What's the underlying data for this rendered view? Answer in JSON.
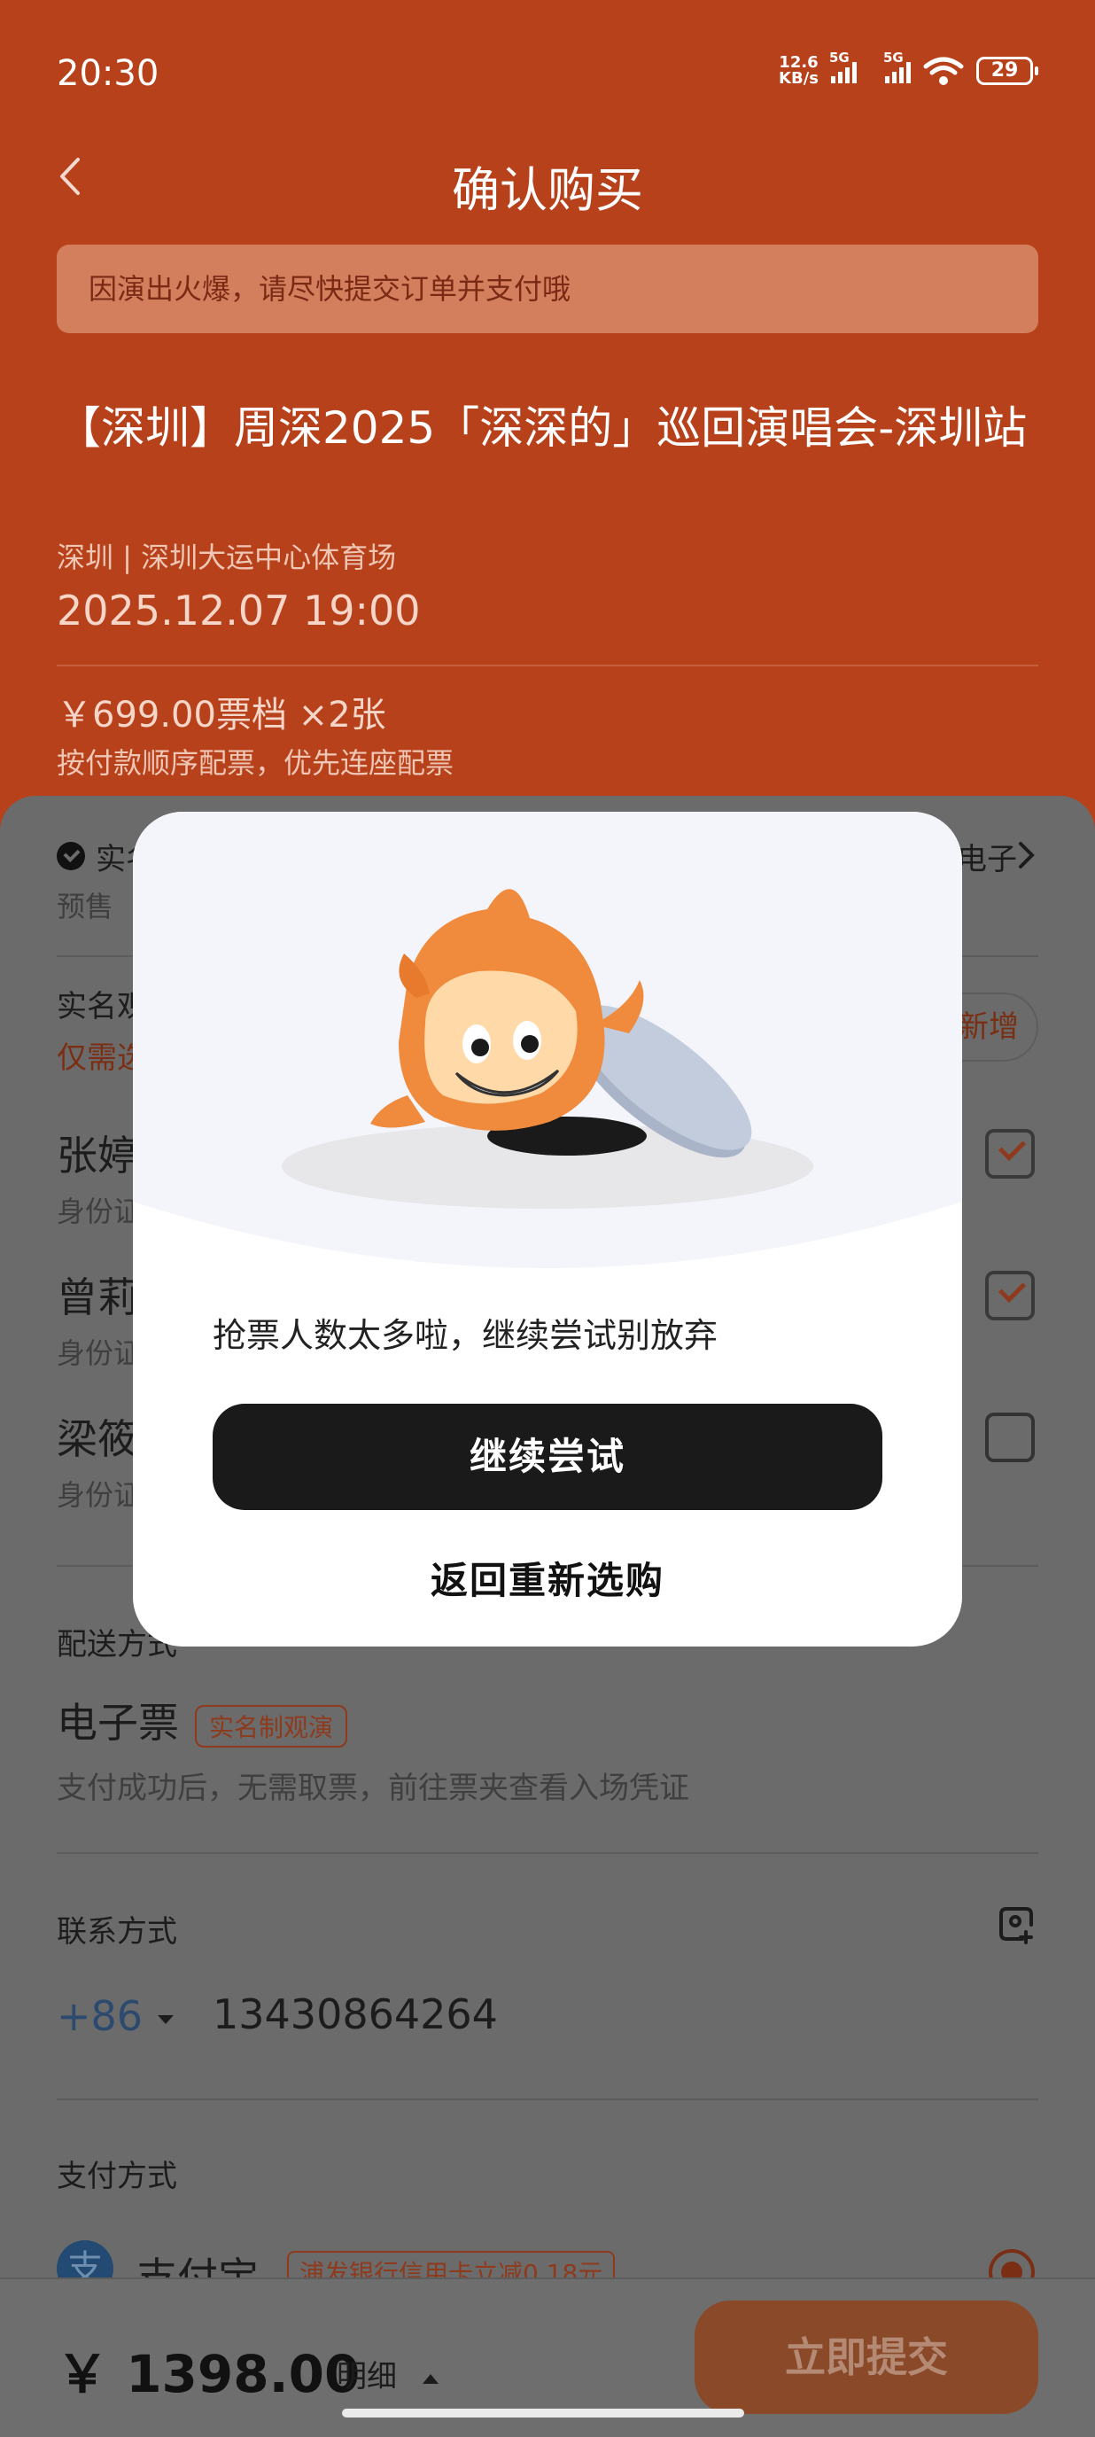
{
  "status_bar": {
    "time": "20:30",
    "net_speed_value": "12.6",
    "net_speed_unit": "KB/s",
    "sim1_label": "5G",
    "sim2_label": "5G",
    "battery": "29"
  },
  "nav": {
    "title": "确认购买"
  },
  "notice": "因演出火爆，请尽快提交订单并支付哦",
  "event": {
    "title": "【深圳】周深2025「深深的」巡回演唱会-深圳站",
    "venue": "深圳 | 深圳大运中心体育场",
    "datetime": "2025.12.07 19:00",
    "price_tier": "￥699.00票档  ×2张",
    "seat_rule": "按付款顺序配票，优先连座配票"
  },
  "sheet": {
    "realname_tag": "实名",
    "eticket_tag": "电子",
    "presale": "预售",
    "realname_viewer_label": "实名观",
    "realname_hint": "仅需选",
    "add_button": "新增",
    "viewers": [
      {
        "name": "张婷",
        "id_label": "身份证",
        "checked": true
      },
      {
        "name": "曾莉",
        "id_label": "身份证",
        "checked": true
      },
      {
        "name": "梁筱",
        "id_label": "身份证",
        "checked": false
      }
    ],
    "delivery_label": "配送方式",
    "delivery_method": "电子票",
    "delivery_tag": "实名制观演",
    "delivery_note": "支付成功后，无需取票，前往票夹查看入场凭证",
    "contact_label": "联系方式",
    "country_code": "+86",
    "phone": "13430864264",
    "payment_label": "支付方式",
    "payment_method": "支付宝",
    "payment_icon_char": "支",
    "payment_promo": "浦发银行信用卡立减0.18元"
  },
  "bottom_bar": {
    "total": "￥ 1398.00",
    "detail": "明细",
    "submit": "立即提交"
  },
  "dialog": {
    "message": "抢票人数太多啦，继续尝试别放弃",
    "primary_button": "继续尝试",
    "secondary_button": "返回重新选购"
  },
  "colors": {
    "header_bg": "#b7411b",
    "dimmed_sheet": "#6b6b6b",
    "primary_button": "#1a1a1a",
    "mascot_orange": "#f08a3c"
  }
}
